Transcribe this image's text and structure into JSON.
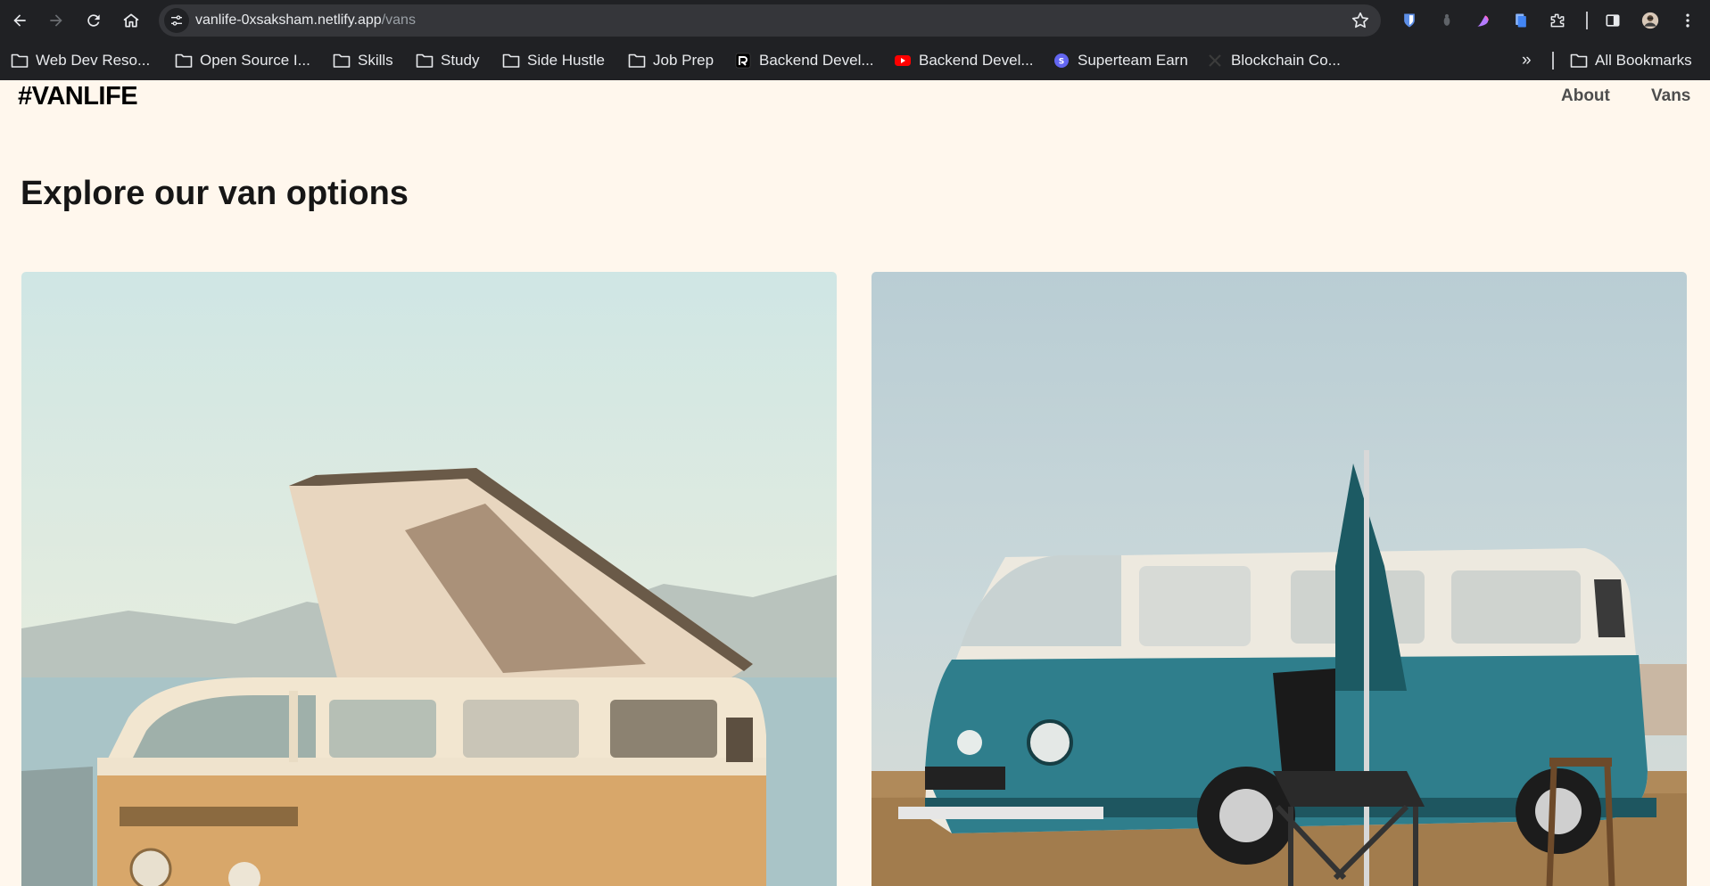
{
  "browser": {
    "url_host": "vanlife-0xsaksham.netlify.app",
    "url_path": "/vans",
    "bookmarks": [
      {
        "label": "Web Dev Reso...",
        "icon": "folder-icon"
      },
      {
        "label": "Open Source I...",
        "icon": "folder-icon"
      },
      {
        "label": "Skills",
        "icon": "folder-icon"
      },
      {
        "label": "Study",
        "icon": "folder-icon"
      },
      {
        "label": "Side Hustle",
        "icon": "folder-icon"
      },
      {
        "label": "Job Prep",
        "icon": "folder-icon"
      },
      {
        "label": "Backend Devel...",
        "icon": "railway-logo-icon"
      },
      {
        "label": "Backend Devel...",
        "icon": "youtube-logo-icon"
      },
      {
        "label": "Superteam Earn",
        "icon": "superteam-logo-icon"
      },
      {
        "label": "Blockchain Co...",
        "icon": "x-logo-icon"
      }
    ],
    "all_bookmarks": "All Bookmarks",
    "overflow": "»"
  },
  "site": {
    "logo": "#VANLIFE",
    "nav": {
      "about": "About",
      "vans": "Vans"
    }
  },
  "page": {
    "title": "Explore our van options"
  },
  "colors": {
    "page_bg": "#fff7ed",
    "chrome_bg": "#202124",
    "omnibox_bg": "#35363a"
  }
}
